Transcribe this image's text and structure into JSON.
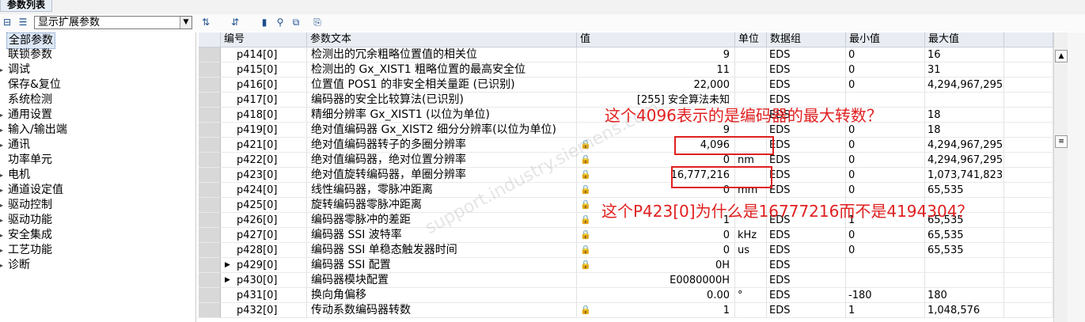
{
  "window": {
    "title": "参数列表"
  },
  "toolbar": {
    "filter_value": "显示扩展参数"
  },
  "nav": {
    "items": [
      {
        "label": "全部参数",
        "selected": true,
        "expander": ""
      },
      {
        "label": "联锁参数",
        "expander": ""
      },
      {
        "label": "调试",
        "expander": "▸"
      },
      {
        "label": "保存&复位",
        "expander": ""
      },
      {
        "label": "系统检测",
        "expander": ""
      },
      {
        "label": "通用设置",
        "expander": "▸"
      },
      {
        "label": "输入/输出端",
        "expander": "▸"
      },
      {
        "label": "通讯",
        "expander": "▸"
      },
      {
        "label": "功率单元",
        "expander": ""
      },
      {
        "label": "电机",
        "expander": "▸"
      },
      {
        "label": "通道设定值",
        "expander": "▸"
      },
      {
        "label": "驱动控制",
        "expander": "▸"
      },
      {
        "label": "驱动功能",
        "expander": "▸"
      },
      {
        "label": "安全集成",
        "expander": "▸"
      },
      {
        "label": "工艺功能",
        "expander": "▸"
      },
      {
        "label": "诊断",
        "expander": "▸"
      }
    ]
  },
  "table": {
    "headers": {
      "num": "编号",
      "text": "参数文本",
      "value": "值",
      "unit": "单位",
      "group": "数据组",
      "min": "最小值",
      "max": "最大值"
    },
    "rows": [
      {
        "num": "p414[0]",
        "text": "检测出的冗余粗略位置值的相关位",
        "value": "9",
        "unit": "",
        "group": "EDS",
        "min": "0",
        "max": "16",
        "lock": false,
        "expand": false
      },
      {
        "num": "p415[0]",
        "text": "检测出的 Gx_XIST1 粗略位置的最高安全位",
        "value": "11",
        "unit": "",
        "group": "EDS",
        "min": "0",
        "max": "31",
        "lock": false,
        "expand": false
      },
      {
        "num": "p416[0]",
        "text": "位置值 POS1 的非安全相关量距 (已识别)",
        "value": "22,000",
        "unit": "",
        "group": "EDS",
        "min": "0",
        "max": "4,294,967,295",
        "lock": false,
        "expand": false
      },
      {
        "num": "p417[0]",
        "text": "编码器的安全比较算法(已识别)",
        "value": "[255] 安全算法未知",
        "unit": "",
        "group": "EDS",
        "min": "",
        "max": "",
        "lock": false,
        "expand": false
      },
      {
        "num": "p418[0]",
        "text": "精细分辨率 Gx_XIST1 (以位为单位)",
        "value": "",
        "unit": "",
        "group": "EDS",
        "min": "",
        "max": "18",
        "lock": false,
        "expand": false
      },
      {
        "num": "p419[0]",
        "text": "绝对值编码器 Gx_XIST2 细分分辨率(以位为单位)",
        "value": "9",
        "unit": "",
        "group": "EDS",
        "min": "0",
        "max": "18",
        "lock": false,
        "expand": false
      },
      {
        "num": "p421[0]",
        "text": "绝对值编码器转子的多圈分辨率",
        "value": "4,096",
        "unit": "",
        "group": "EDS",
        "min": "0",
        "max": "4,294,967,295",
        "lock": true,
        "expand": false
      },
      {
        "num": "p422[0]",
        "text": "绝对值编码器，绝对位置分辨率",
        "value": "0",
        "unit": "nm",
        "group": "EDS",
        "min": "0",
        "max": "4,294,967,295",
        "lock": true,
        "expand": false
      },
      {
        "num": "p423[0]",
        "text": "绝对值旋转编码器，单圈分辨率",
        "value": "16,777,216",
        "unit": "",
        "group": "EDS",
        "min": "0",
        "max": "1,073,741,823",
        "lock": true,
        "expand": false
      },
      {
        "num": "p424[0]",
        "text": "线性编码器，零脉冲距离",
        "value": "0",
        "unit": "mm",
        "group": "EDS",
        "min": "0",
        "max": "65,535",
        "lock": true,
        "expand": false
      },
      {
        "num": "p425[0]",
        "text": "旋转编码器零脉冲距离",
        "value": "",
        "unit": "",
        "group": "",
        "min": "",
        "max": "",
        "lock": true,
        "expand": false
      },
      {
        "num": "p426[0]",
        "text": "编码器零脉冲的差距",
        "value": "1",
        "unit": "",
        "group": "EDS",
        "min": "1",
        "max": "65,535",
        "lock": true,
        "expand": false
      },
      {
        "num": "p427[0]",
        "text": "编码器 SSI 波特率",
        "value": "0",
        "unit": "kHz",
        "group": "EDS",
        "min": "0",
        "max": "65,535",
        "lock": true,
        "expand": false
      },
      {
        "num": "p428[0]",
        "text": "编码器 SSI 单稳态触发器时间",
        "value": "0",
        "unit": "us",
        "group": "EDS",
        "min": "0",
        "max": "65,535",
        "lock": true,
        "expand": false
      },
      {
        "num": "p429[0]",
        "text": "编码器 SSI 配置",
        "value": "0H",
        "unit": "",
        "group": "EDS",
        "min": "",
        "max": "",
        "lock": true,
        "expand": true
      },
      {
        "num": "p430[0]",
        "text": "编码器模块配置",
        "value": "E0080000H",
        "unit": "",
        "group": "EDS",
        "min": "",
        "max": "",
        "lock": false,
        "expand": true
      },
      {
        "num": "p431[0]",
        "text": "换向角偏移",
        "value": "0.00",
        "unit": "°",
        "group": "EDS",
        "min": "-180",
        "max": "180",
        "lock": false,
        "expand": false
      },
      {
        "num": "p432[0]",
        "text": "传动系数编码器转数",
        "value": "1",
        "unit": "",
        "group": "EDS",
        "min": "1",
        "max": "1,048,576",
        "lock": true,
        "expand": false
      }
    ]
  },
  "annotations": {
    "q1": "这个4096表示的是编码器的最大转数？",
    "q2": "这个P423[0]为什么是16777216而不是4194304？"
  },
  "watermark": "support.industry.siemens.com",
  "colors": {
    "annotation": "#e02020",
    "lock": "#c89a00",
    "selection": "#dde8f7"
  }
}
